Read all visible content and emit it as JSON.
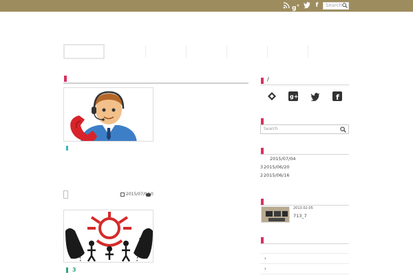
{
  "topbar": {
    "bg_color": "#9d8d5e",
    "icons": [
      "rss-icon",
      "google-plus-icon",
      "twitter-icon",
      "facebook-icon"
    ],
    "search_placeholder": "Search"
  },
  "sidebar": {
    "heading_slash": "/",
    "social_icons": [
      "feedly-icon",
      "google-plus-icon",
      "twitter-icon",
      "facebook-icon"
    ],
    "search_placeholder": "Search",
    "recent": [
      {
        "prefix": "",
        "date": "2015/07/04"
      },
      {
        "prefix": "3",
        "date": "2015/06/20"
      },
      {
        "prefix": "2",
        "date": "2015/06/16"
      }
    ],
    "popular": {
      "date": "2013.02.05",
      "title": "713_7"
    }
  },
  "main": {
    "post1": {
      "thumb_alt": "telephone-support-person"
    },
    "post2": {
      "date": "2015/07/04",
      "comments": "0",
      "title_suffix": "3"
    }
  },
  "accent": "#d9305e"
}
